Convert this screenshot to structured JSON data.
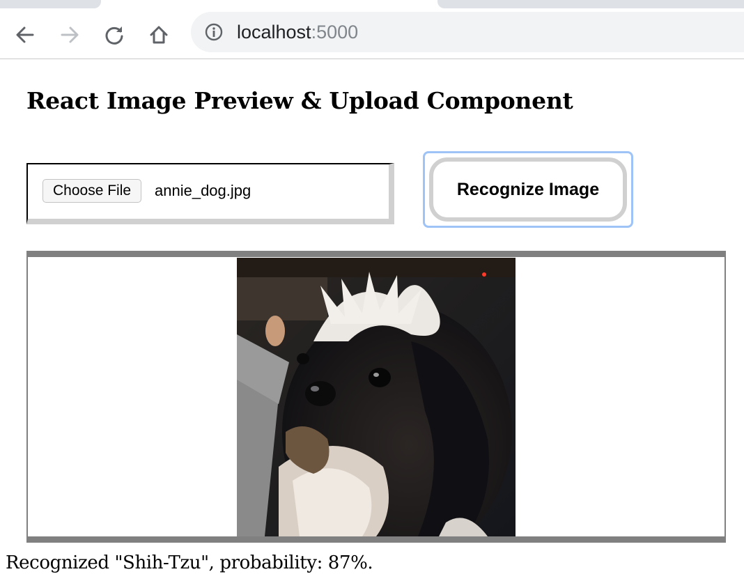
{
  "browser": {
    "url_host": "localhost",
    "url_port": ":5000",
    "icons": {
      "back": "back-arrow-icon",
      "forward": "forward-arrow-icon",
      "reload": "reload-icon",
      "home": "home-icon",
      "site_info": "info-icon"
    }
  },
  "page": {
    "title": "React Image Preview & Upload Component",
    "file_input": {
      "button_label": "Choose File",
      "file_name": "annie_dog.jpg"
    },
    "recognize_button_label": "Recognize Image",
    "preview": {
      "alt": "annie_dog.jpg"
    },
    "result": "Recognized \"Shih-Tzu\", probability: 87%."
  },
  "colors": {
    "focus_ring": "#9ec3f7",
    "frame_border": "#808080",
    "omnibox_bg": "#f1f3f4"
  }
}
